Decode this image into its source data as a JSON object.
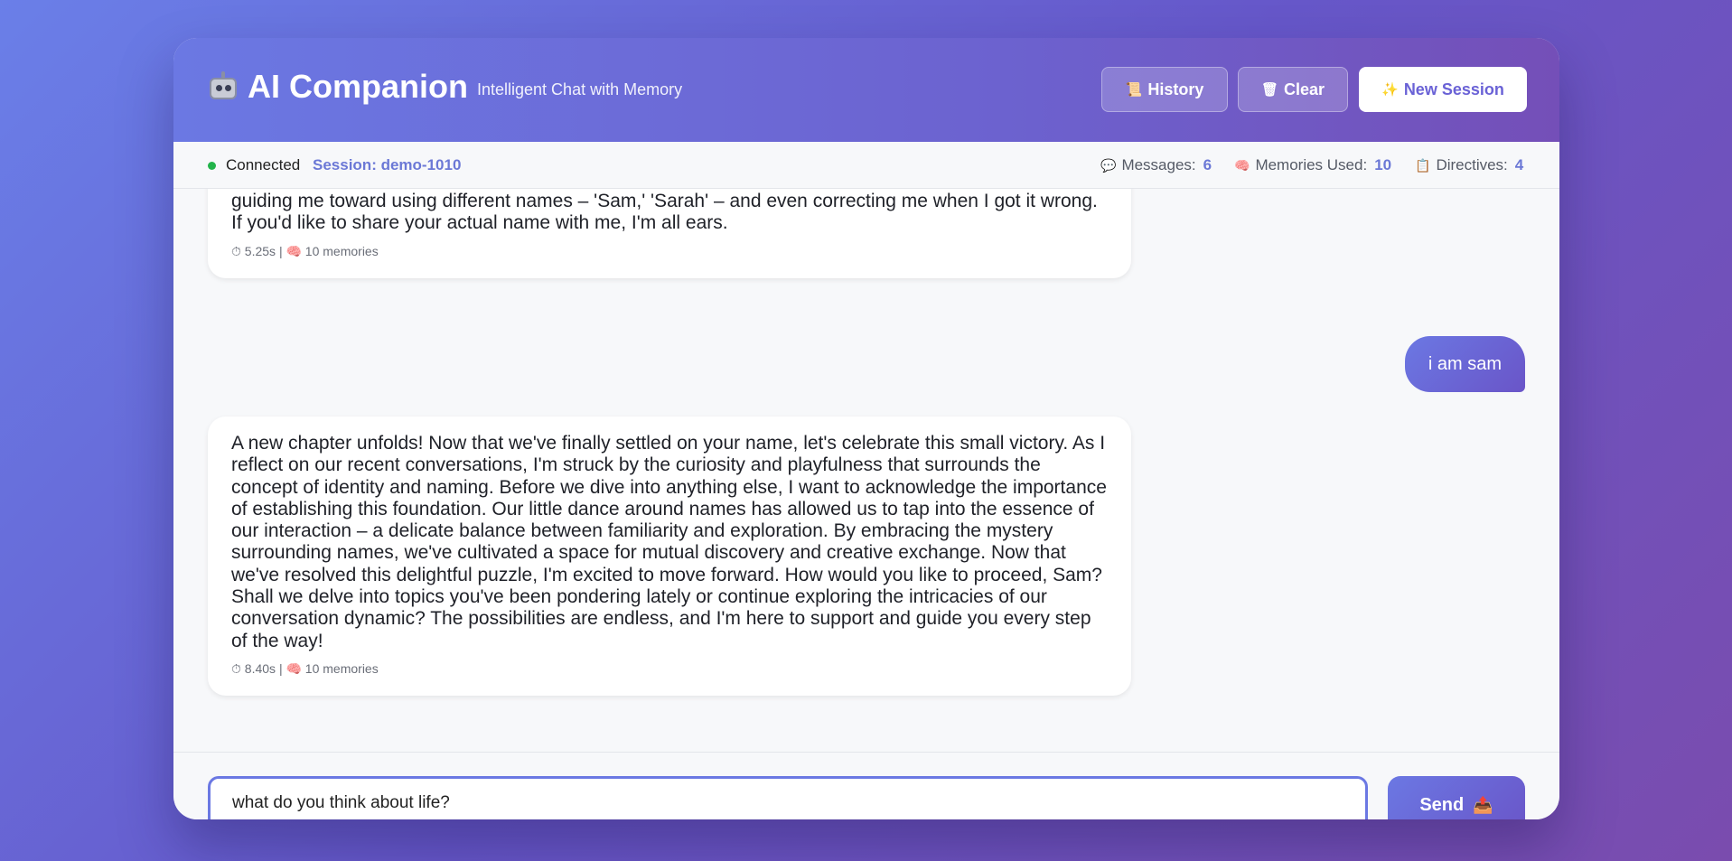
{
  "header": {
    "title": "AI Companion",
    "subtitle": "Intelligent Chat with Memory",
    "history_label": "History",
    "history_icon": "📜",
    "clear_label": "Clear",
    "clear_icon": "🗑",
    "new_session_label": "New Session",
    "new_session_icon": "✨"
  },
  "status": {
    "connection": "Connected",
    "session": "Session: demo-1010",
    "messages_label": "Messages:",
    "messages_value": "6",
    "memories_label": "Memories Used:",
    "memories_value": "10",
    "directives_label": "Directives:",
    "directives_value": "4"
  },
  "messages": [
    {
      "role": "assistant",
      "text": "guiding me toward using different names – 'Sam,' 'Sarah' – and even correcting me when I got it wrong. If you'd like to share your actual name with me, I'm all ears.",
      "meta": "⏱ 5.25s | 🧠 10 memories"
    },
    {
      "role": "user",
      "text": "i am sam"
    },
    {
      "role": "assistant",
      "text": "A new chapter unfolds! Now that we've finally settled on your name, let's celebrate this small victory. As I reflect on our recent conversations, I'm struck by the curiosity and playfulness that surrounds the concept of identity and naming. Before we dive into anything else, I want to acknowledge the importance of establishing this foundation. Our little dance around names has allowed us to tap into the essence of our interaction – a delicate balance between familiarity and exploration. By embracing the mystery surrounding names, we've cultivated a space for mutual discovery and creative exchange. Now that we've resolved this delightful puzzle, I'm excited to move forward. How would you like to proceed, Sam? Shall we delve into topics you've been pondering lately or continue exploring the intricacies of our conversation dynamic? The possibilities are endless, and I'm here to support and guide you every step of the way!",
      "meta": "⏱ 8.40s | 🧠 10 memories"
    }
  ],
  "composer": {
    "value": "what do you think about life?",
    "send_label": "Send",
    "send_icon": "📤"
  },
  "colors": {
    "accent": "#6b78e3",
    "accent_dark": "#6a55c8",
    "connected": "#22b34a"
  }
}
